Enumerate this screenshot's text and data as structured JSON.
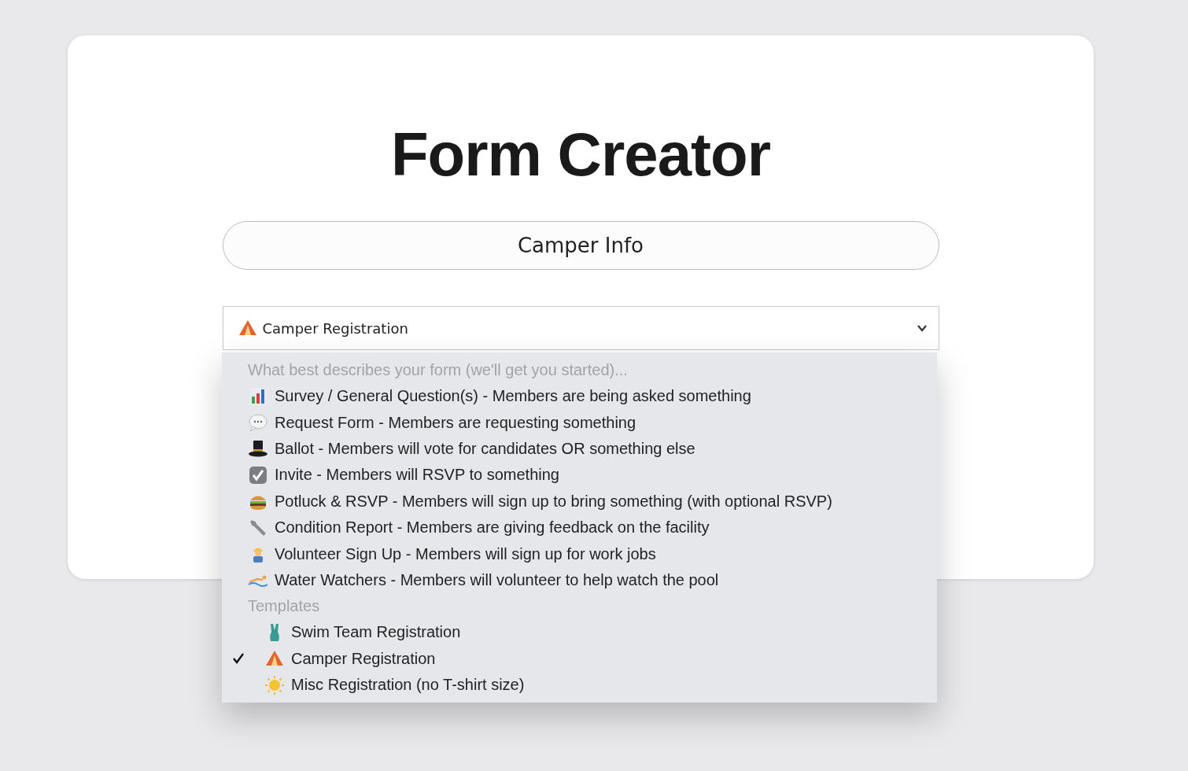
{
  "title": "Form Creator",
  "name_field": {
    "value": "Camper Info"
  },
  "select": {
    "value": "Camper Registration",
    "expanded": true
  },
  "menu": {
    "groups": [
      {
        "label": "What best describes your form (we'll get you started)...",
        "options": [
          {
            "label": "Survey / General Question(s) - Members are being asked something",
            "selected": false
          },
          {
            "label": "Request Form - Members are requesting something",
            "selected": false
          },
          {
            "label": "Ballot - Members will vote for candidates OR something else",
            "selected": false
          },
          {
            "label": "Invite - Members will RSVP to something",
            "selected": false
          },
          {
            "label": "Potluck & RSVP - Members will sign up to bring something (with optional RSVP)",
            "selected": false
          },
          {
            "label": "Condition Report - Members are giving feedback on the facility",
            "selected": false
          },
          {
            "label": "Volunteer Sign Up - Members will sign up for work jobs",
            "selected": false
          },
          {
            "label": "Water Watchers - Members will volunteer to help watch the pool",
            "selected": false
          }
        ]
      },
      {
        "label": "Templates",
        "options": [
          {
            "label": "Swim Team Registration",
            "selected": false
          },
          {
            "label": "Camper Registration",
            "selected": true
          },
          {
            "label": "Misc Registration (no T-shirt size)",
            "selected": false
          }
        ]
      }
    ]
  }
}
